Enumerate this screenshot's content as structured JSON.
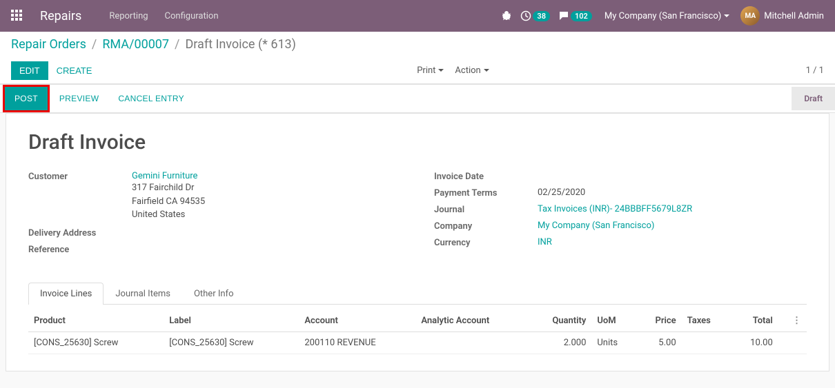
{
  "navbar": {
    "brand": "Repairs",
    "menu": [
      "Reporting",
      "Configuration"
    ],
    "activities_badge": "38",
    "discuss_badge": "102",
    "company": "My Company (San Francisco)",
    "user": "Mitchell Admin"
  },
  "breadcrumb": {
    "items": [
      "Repair Orders",
      "RMA/00007"
    ],
    "current": "Draft Invoice (* 613)"
  },
  "toolbar": {
    "edit": "Edit",
    "create": "Create",
    "print": "Print",
    "action": "Action",
    "pager": "1 / 1"
  },
  "status": {
    "post": "Post",
    "preview": "Preview",
    "cancel": "Cancel Entry",
    "stage": "Draft"
  },
  "form": {
    "title": "Draft Invoice",
    "left": {
      "customer_label": "Customer",
      "customer_name": "Gemini Furniture",
      "address": [
        "317 Fairchild Dr",
        "Fairfield CA 94535",
        "United States"
      ],
      "delivery_label": "Delivery Address",
      "reference_label": "Reference"
    },
    "right": {
      "invoice_date_label": "Invoice Date",
      "invoice_date": "",
      "payment_terms_label": "Payment Terms",
      "payment_terms": "02/25/2020",
      "journal_label": "Journal",
      "journal": "Tax Invoices (INR)- 24BBBFF5679L8ZR",
      "company_label": "Company",
      "company": "My Company (San Francisco)",
      "currency_label": "Currency",
      "currency": "INR"
    }
  },
  "tabs": [
    "Invoice Lines",
    "Journal Items",
    "Other Info"
  ],
  "lines": {
    "headers": {
      "product": "Product",
      "label": "Label",
      "account": "Account",
      "analytic": "Analytic Account",
      "quantity": "Quantity",
      "uom": "UoM",
      "price": "Price",
      "taxes": "Taxes",
      "total": "Total"
    },
    "rows": [
      {
        "product": "[CONS_25630] Screw",
        "label": "[CONS_25630] Screw",
        "account": "200110 REVENUE",
        "analytic": "",
        "quantity": "2.000",
        "uom": "Units",
        "price": "5.00",
        "taxes": "",
        "total": "10.00"
      }
    ]
  }
}
